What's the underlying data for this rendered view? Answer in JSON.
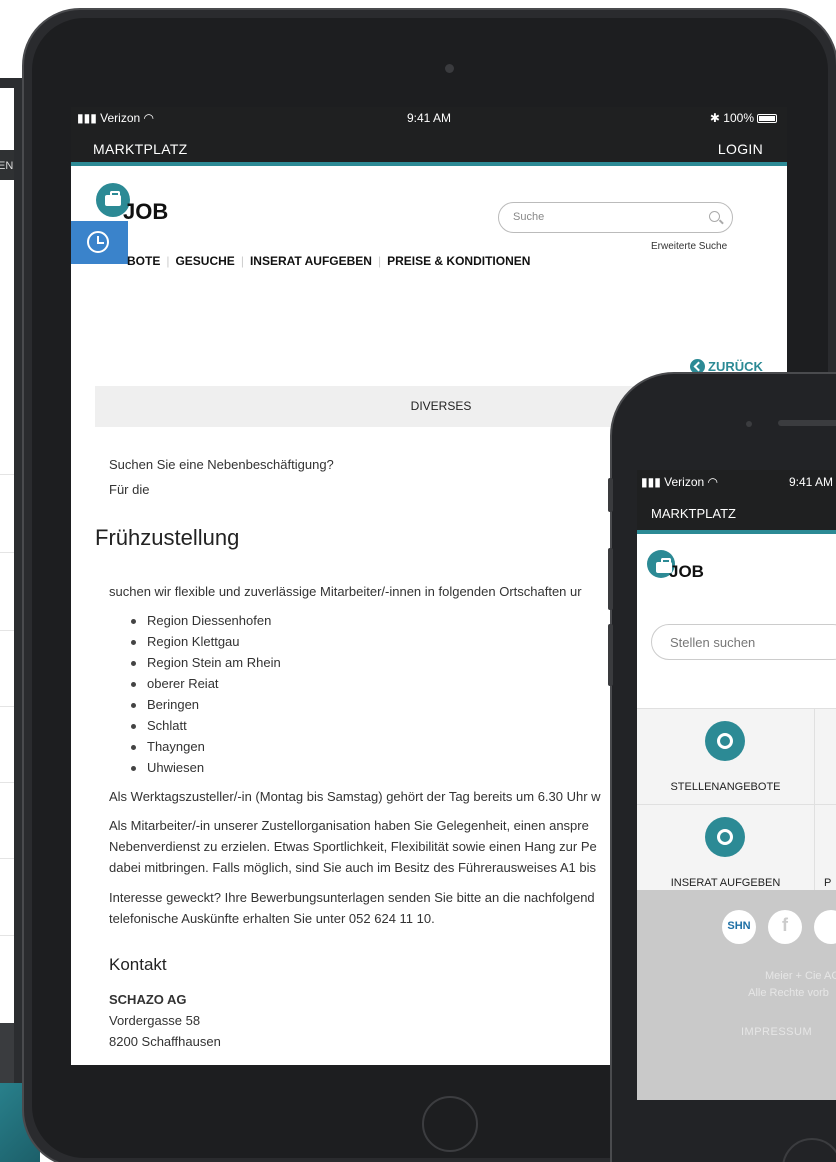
{
  "background_device": {
    "nav_fragment": "EN"
  },
  "tablet": {
    "status": {
      "carrier": "Verizon",
      "time": "9:41 AM",
      "battery": "100%"
    },
    "topnav": {
      "left": "MARKTPLATZ",
      "right": "LOGIN"
    },
    "logo_text": "JOB",
    "search": {
      "placeholder": "Suche",
      "advanced": "Erweiterte Suche"
    },
    "nav": [
      "BOTE",
      "GESUCHE",
      "INSERAT AUFGEBEN",
      "PREISE & KONDITIONEN"
    ],
    "back": "ZURÜCK",
    "category": "DIVERSES",
    "intro_1": "Suchen Sie eine Nebenbeschäftigung?",
    "intro_2": "Für die",
    "heading": "Frühzustellung",
    "para_1": "suchen wir flexible und zuverlässige Mitarbeiter/-innen in folgenden Ortschaften ur",
    "regions": [
      "Region Diessenhofen",
      "Region Klettgau",
      "Region Stein am Rhein",
      "oberer Reiat",
      "Beringen",
      "Schlatt",
      "Thayngen",
      "Uhwiesen"
    ],
    "para_2": "Als Werktagszusteller/-in (Montag bis Samstag) gehört der Tag bereits um 6.30 Uhr w",
    "para_3_l1": "Als Mitarbeiter/-in unserer Zustellorganisation haben Sie Gelegenheit, einen anspre",
    "para_3_l2": "Nebenverdienst zu erzielen. Etwas Sportlichkeit, Flexibilität sowie einen Hang zur Pe",
    "para_3_l3": "dabei mitbringen. Falls möglich, sind Sie auch im Besitz des Führerausweises A1 bis",
    "para_4_l1": "Interesse geweckt? Ihre Bewerbungsunterlagen senden Sie bitte an die nachfolgend",
    "para_4_l2": "telefonische Auskünfte erhalten Sie unter 052 624 11 10.",
    "contact_heading": "Kontakt",
    "contact": {
      "company": "SCHAZO AG",
      "street": "Vordergasse 58",
      "city": "8200 Schaffhausen"
    }
  },
  "phone": {
    "status": {
      "carrier": "Verizon",
      "time": "9:41 AM"
    },
    "topnav": "MARKTPLATZ",
    "logo_text": "JOB",
    "search_placeholder": "Stellen suchen",
    "tiles": [
      "STELLENANGEBOTE",
      "INSERAT AUFGEBEN"
    ],
    "tile_partial": "P",
    "social": {
      "shn": "SHN",
      "facebook": "f"
    },
    "copyright_l1": "Meier + Cie AG",
    "copyright_l2": "Alle Rechte vorb",
    "impressum": "IMPRESSUM"
  },
  "colors": {
    "accent": "#2c8a95",
    "history_button": "#3a83cb",
    "dark_bar": "#1f2021"
  }
}
